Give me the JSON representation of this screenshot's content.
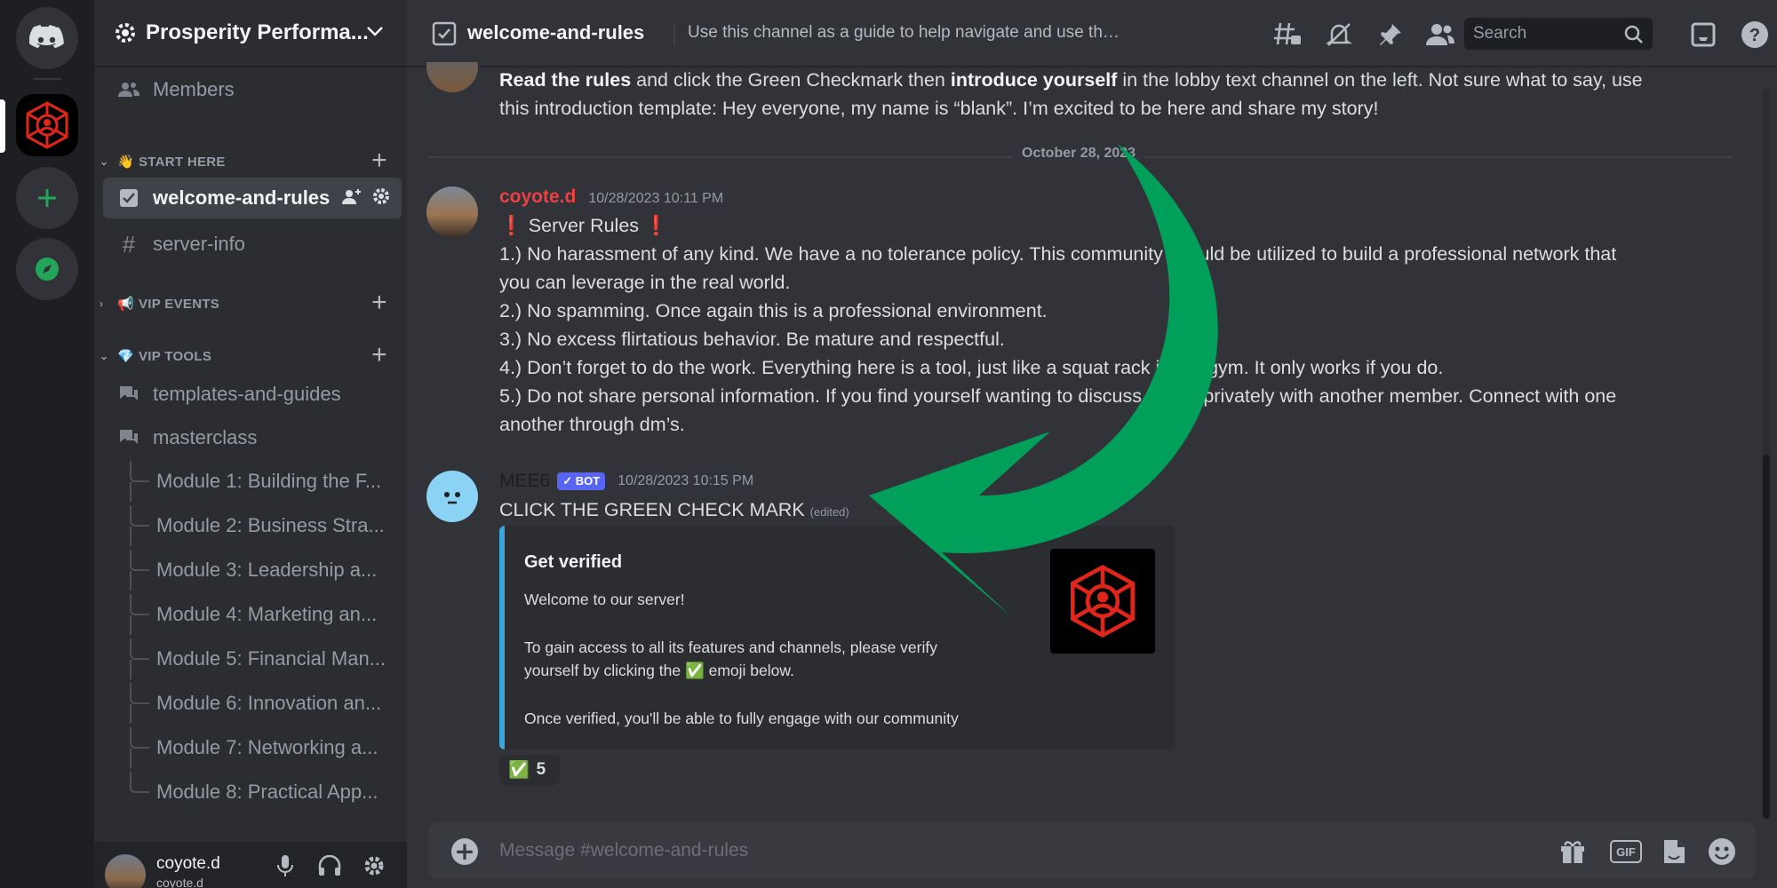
{
  "server": {
    "name": "Prosperity Performa...",
    "rail": {
      "home_icon": "discord-logo-icon",
      "add_icon": "plus-icon",
      "explore_icon": "compass-icon"
    }
  },
  "sidebar": {
    "members_label": "Members",
    "categories": [
      {
        "label": "START HERE",
        "emoji": "👋"
      },
      {
        "label": "VIP EVENTS",
        "emoji": "📢"
      },
      {
        "label": "VIP TOOLS",
        "emoji": "💎"
      }
    ],
    "channels": {
      "welcome": "welcome-and-rules",
      "server_info": "server-info",
      "templates": "templates-and-guides",
      "masterclass": "masterclass"
    },
    "threads": [
      "Module 1: Building the F...",
      "Module 2: Business Stra...",
      "Module 3: Leadership a...",
      "Module 4: Marketing an...",
      "Module 5: Financial Man...",
      "Module 6: Innovation an...",
      "Module 7: Networking a...",
      "Module 8: Practical App..."
    ]
  },
  "user_panel": {
    "name": "coyote.d",
    "sub": "coyote.d"
  },
  "topbar": {
    "channel": "welcome-and-rules",
    "topic": "Use this channel as a guide to help navigate and use the tools and cha...",
    "search_placeholder": "Search"
  },
  "messages": {
    "first": {
      "line1_bold_a": "Read the rules",
      "line1_mid": " and click the Green Checkmark then ",
      "line1_bold_b": "introduce yourself",
      "line1_end": " in the lobby text channel on the left. Not sure what to say, use",
      "line2": "this introduction template: Hey everyone, my name is “blank”. I’m excited to be here and share my story!"
    },
    "date_divider": "October 28, 2023",
    "rules": {
      "author": "coyote.d",
      "timestamp": "10/28/2023 10:11 PM",
      "title": "Server Rules",
      "lines": [
        "1.) No harassment of any kind. We have a no tolerance policy. This community should be utilized to build a professional network that",
        "you can leverage in the real world.",
        "2.) No spamming. Once again this is a professional environment.",
        "3.) No excess flirtatious behavior. Be mature and respectful.",
        "4.) Don’t forget to do the work. Everything here is a tool, just like a squat rack in the gym. It only works if you do.",
        "5.) Do not share personal information. If you find yourself wanting to discuss things privately with another member. Connect with one",
        "another through dm’s."
      ]
    },
    "bot": {
      "author": "MEE6",
      "badge": "✓ BOT",
      "timestamp": "10/28/2023 10:15 PM",
      "content": "CLICK THE GREEN CHECK MARK",
      "edited": "(edited)",
      "embed": {
        "title": "Get verified",
        "line1": "Welcome to our server!",
        "line2": "To gain access to all its features and channels, please verify",
        "line3_a": "yourself by clicking the",
        "line3_b": "emoji below.",
        "line4": "Once verified, you'll be able to fully engage with our community"
      },
      "reaction": {
        "emoji": "✅",
        "count": "5"
      }
    }
  },
  "composer": {
    "placeholder": "Message #welcome-and-rules",
    "gif_label": "GIF"
  },
  "colors": {
    "accent_green": "#00a05a",
    "embed_border": "#3ba5dc",
    "author_red": "#f23f43",
    "bot_badge": "#5865f2"
  }
}
